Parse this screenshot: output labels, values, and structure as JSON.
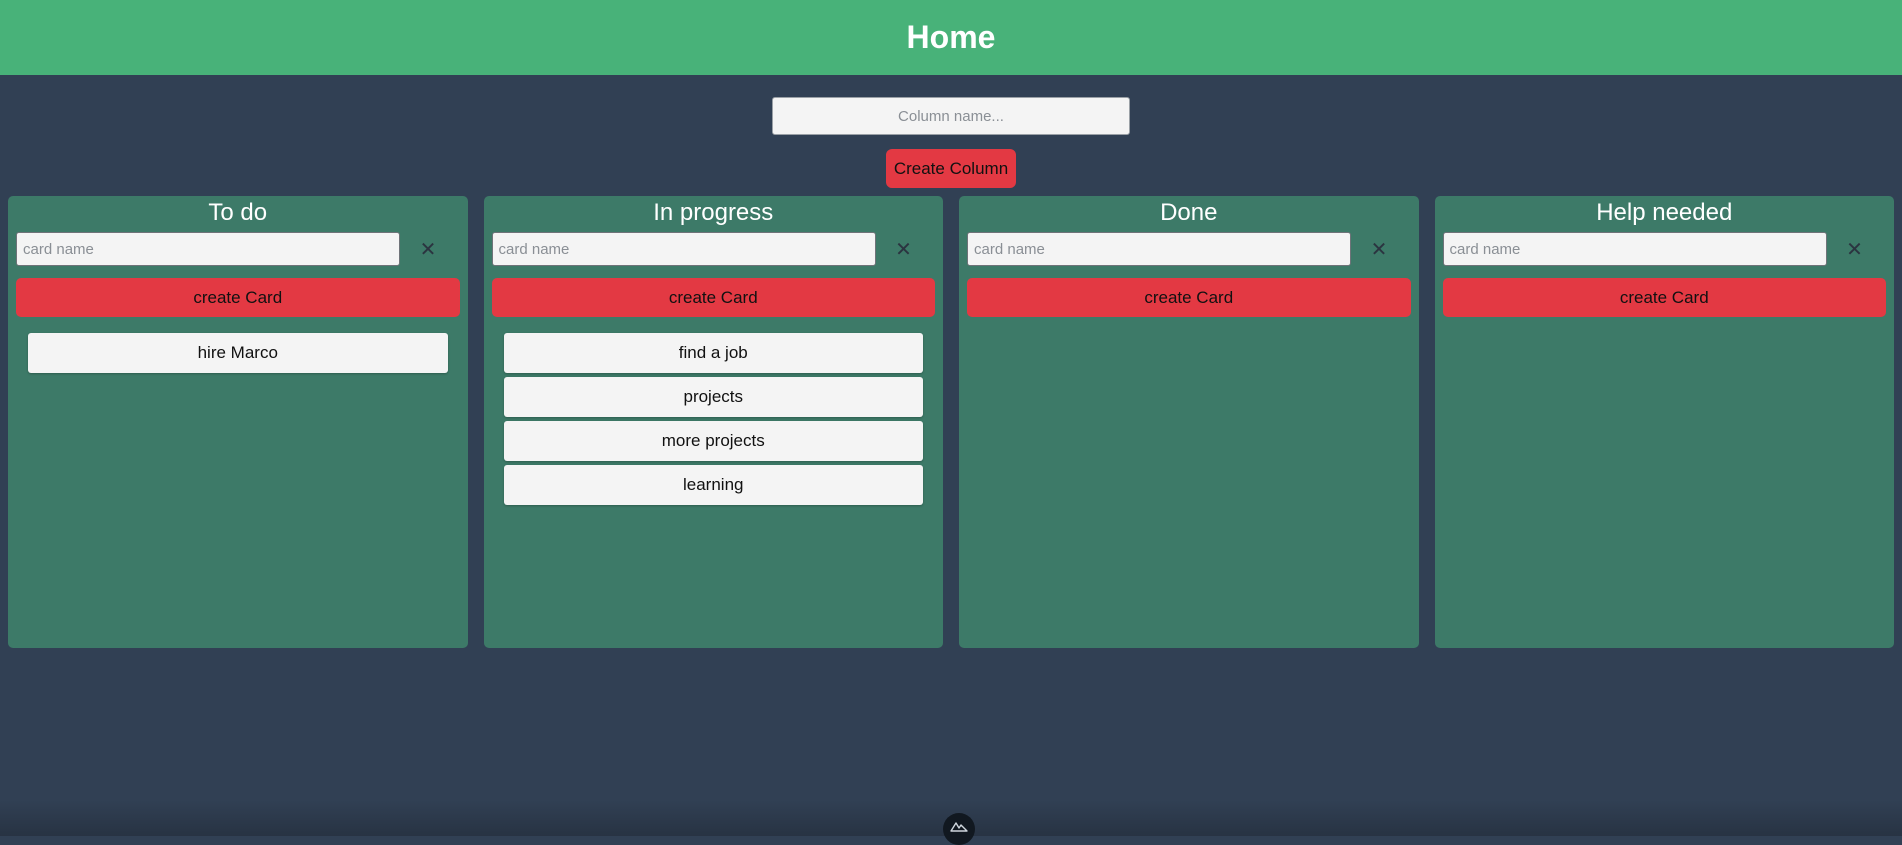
{
  "header": {
    "title": "Home"
  },
  "new_column": {
    "placeholder": "Column name...",
    "button_label": "Create Column"
  },
  "columns": [
    {
      "title": "To do",
      "card_placeholder": "card name",
      "delete_glyph": "✕",
      "create_label": "create Card",
      "cards": [
        "hire Marco"
      ]
    },
    {
      "title": "In progress",
      "card_placeholder": "card name",
      "delete_glyph": "✕",
      "create_label": "create Card",
      "cards": [
        "find a job",
        "projects",
        "more projects",
        "learning"
      ]
    },
    {
      "title": "Done",
      "card_placeholder": "card name",
      "delete_glyph": "✕",
      "create_label": "create Card",
      "cards": []
    },
    {
      "title": "Help needed",
      "card_placeholder": "card name",
      "delete_glyph": "✕",
      "create_label": "create Card",
      "cards": []
    }
  ],
  "colors": {
    "header_bg": "#48b279",
    "page_bg": "#314054",
    "column_bg": "#3d7a68",
    "button_red": "#e33943"
  },
  "icons": {
    "devtools": "nuxt-devtools-icon",
    "delete": "close-icon"
  }
}
